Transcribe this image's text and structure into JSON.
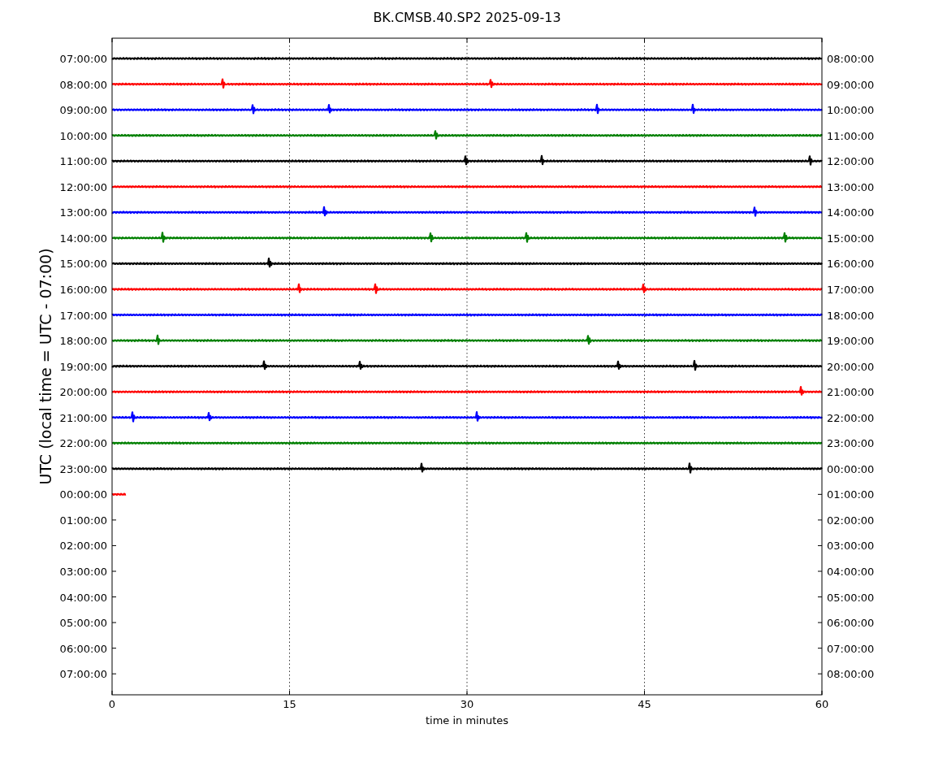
{
  "plot": {
    "title": "BK.CMSB.40.SP2 2025-09-13",
    "xlabel": "time in minutes",
    "ylabel": "UTC (local time = UTC - 07:00)",
    "xticks": [
      "0",
      "15",
      "30",
      "45",
      "60"
    ],
    "rows": [
      {
        "left": "07:00:00",
        "right": "08:00:00",
        "color": "#000000",
        "level": 1
      },
      {
        "left": "08:00:00",
        "right": "09:00:00",
        "color": "#ff0000",
        "level": 1
      },
      {
        "left": "09:00:00",
        "right": "10:00:00",
        "color": "#0000ff",
        "level": 1
      },
      {
        "left": "10:00:00",
        "right": "11:00:00",
        "color": "#008000",
        "level": 1
      },
      {
        "left": "11:00:00",
        "right": "12:00:00",
        "color": "#000000",
        "level": 1
      },
      {
        "left": "12:00:00",
        "right": "13:00:00",
        "color": "#ff0000",
        "level": 1
      },
      {
        "left": "13:00:00",
        "right": "14:00:00",
        "color": "#0000ff",
        "level": 1
      },
      {
        "left": "14:00:00",
        "right": "15:00:00",
        "color": "#008000",
        "level": 1
      },
      {
        "left": "15:00:00",
        "right": "16:00:00",
        "color": "#000000",
        "level": 1
      },
      {
        "left": "16:00:00",
        "right": "17:00:00",
        "color": "#ff0000",
        "level": 1
      },
      {
        "left": "17:00:00",
        "right": "18:00:00",
        "color": "#0000ff",
        "level": 1
      },
      {
        "left": "18:00:00",
        "right": "19:00:00",
        "color": "#008000",
        "level": 1
      },
      {
        "left": "19:00:00",
        "right": "20:00:00",
        "color": "#000000",
        "level": 1
      },
      {
        "left": "20:00:00",
        "right": "21:00:00",
        "color": "#ff0000",
        "level": 1
      },
      {
        "left": "21:00:00",
        "right": "22:00:00",
        "color": "#0000ff",
        "level": 1
      },
      {
        "left": "22:00:00",
        "right": "23:00:00",
        "color": "#008000",
        "level": 1
      },
      {
        "left": "23:00:00",
        "right": "00:00:00",
        "color": "#000000",
        "level": 1
      },
      {
        "left": "00:00:00",
        "right": "01:00:00",
        "color": "#ff0000",
        "level": 0.02
      },
      {
        "left": "01:00:00",
        "right": "02:00:00"
      },
      {
        "left": "02:00:00",
        "right": "03:00:00"
      },
      {
        "left": "03:00:00",
        "right": "04:00:00"
      },
      {
        "left": "04:00:00",
        "right": "05:00:00"
      },
      {
        "left": "05:00:00",
        "right": "06:00:00"
      },
      {
        "left": "06:00:00",
        "right": "07:00:00"
      },
      {
        "left": "07:00:00",
        "right": "08:00:00"
      }
    ]
  }
}
